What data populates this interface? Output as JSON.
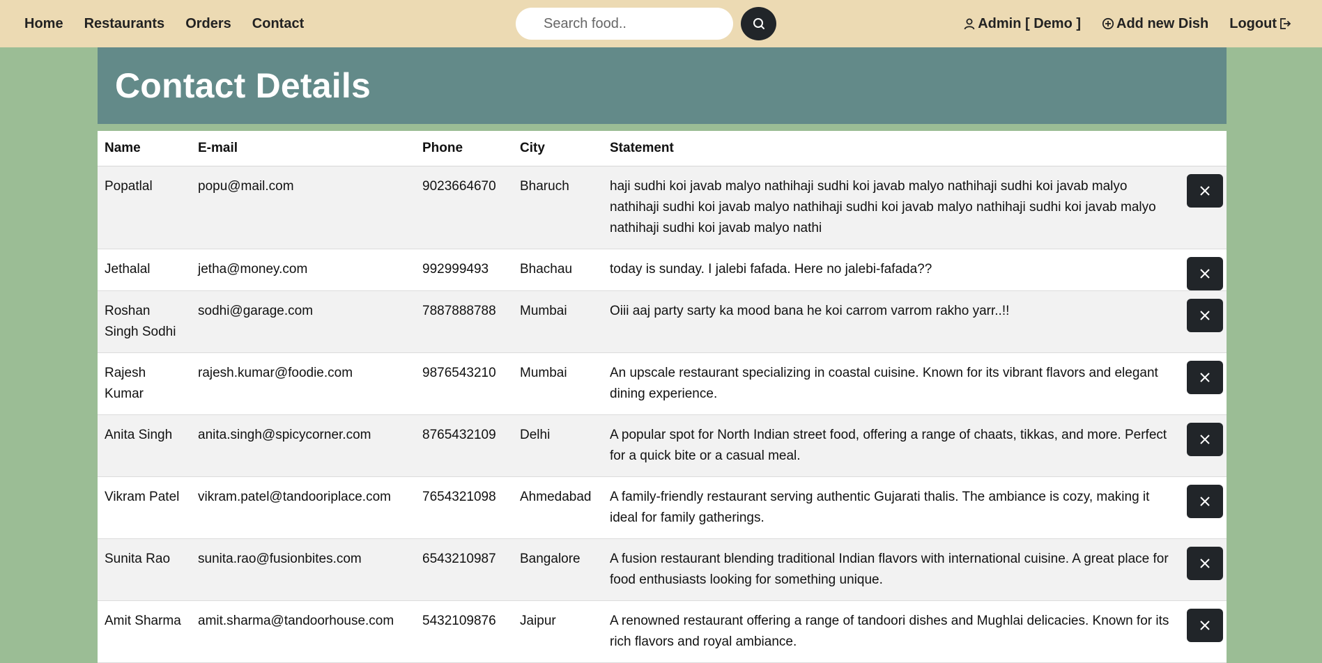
{
  "nav": {
    "links": [
      "Home",
      "Restaurants",
      "Orders",
      "Contact"
    ],
    "search_placeholder": "Search food..",
    "admin_label": "Admin [ Demo ]",
    "add_dish_label": "Add new Dish",
    "logout_label": "Logout"
  },
  "page": {
    "title": "Contact Details"
  },
  "table": {
    "headers": [
      "Name",
      "E-mail",
      "Phone",
      "City",
      "Statement"
    ],
    "rows": [
      {
        "name": "Popatlal",
        "email": "popu@mail.com",
        "phone": "9023664670",
        "city": "Bharuch",
        "statement": "haji sudhi koi javab malyo nathihaji sudhi koi javab malyo nathihaji sudhi koi javab malyo nathihaji sudhi koi javab malyo nathihaji sudhi koi javab malyo nathihaji sudhi koi javab malyo nathihaji sudhi koi javab malyo nathi"
      },
      {
        "name": "Jethalal",
        "email": "jetha@money.com",
        "phone": "992999493",
        "city": "Bhachau",
        "statement": "today is sunday. I jalebi fafada. Here no jalebi-fafada??"
      },
      {
        "name": "Roshan Singh Sodhi",
        "email": "sodhi@garage.com",
        "phone": "7887888788",
        "city": "Mumbai",
        "statement": "Oiii aaj party sarty ka mood bana he koi carrom varrom rakho yarr..!!"
      },
      {
        "name": "Rajesh Kumar",
        "email": "rajesh.kumar@foodie.com",
        "phone": "9876543210",
        "city": "Mumbai",
        "statement": "An upscale restaurant specializing in coastal cuisine. Known for its vibrant flavors and elegant dining experience."
      },
      {
        "name": "Anita Singh",
        "email": "anita.singh@spicycorner.com",
        "phone": "8765432109",
        "city": "Delhi",
        "statement": "A popular spot for North Indian street food, offering a range of chaats, tikkas, and more. Perfect for a quick bite or a casual meal."
      },
      {
        "name": "Vikram Patel",
        "email": "vikram.patel@tandooriplace.com",
        "phone": "7654321098",
        "city": "Ahmedabad",
        "statement": "A family-friendly restaurant serving authentic Gujarati thalis. The ambiance is cozy, making it ideal for family gatherings."
      },
      {
        "name": "Sunita Rao",
        "email": "sunita.rao@fusionbites.com",
        "phone": "6543210987",
        "city": "Bangalore",
        "statement": "A fusion restaurant blending traditional Indian flavors with international cuisine. A great place for food enthusiasts looking for something unique."
      },
      {
        "name": "Amit Sharma",
        "email": "amit.sharma@tandoorhouse.com",
        "phone": "5432109876",
        "city": "Jaipur",
        "statement": "A renowned restaurant offering a range of tandoori dishes and Mughlai delicacies. Known for its rich flavors and royal ambiance."
      }
    ]
  },
  "icons": {
    "search": "search-icon",
    "admin": "user-icon",
    "add": "plus-circle-icon",
    "logout": "logout-icon",
    "delete": "close-icon"
  },
  "colors": {
    "navbar_bg": "#ecdab3",
    "page_bg": "#9bbd95",
    "header_band": "#638a89",
    "button_dark": "#212529"
  }
}
